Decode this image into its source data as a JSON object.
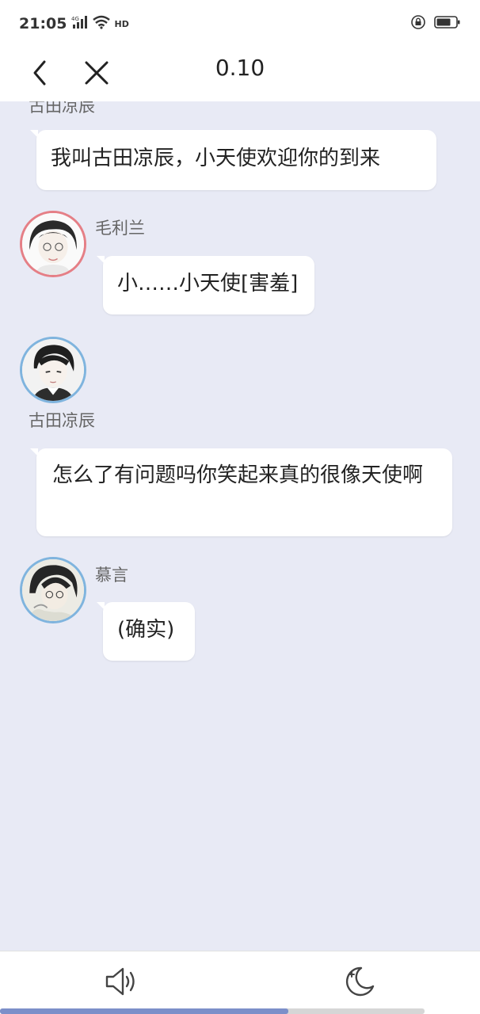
{
  "status_bar": {
    "time": "21:05",
    "network": "4G",
    "hd": "HD",
    "icons": [
      "signal-icon",
      "wifi-icon",
      "lock-rotation-icon",
      "battery-icon"
    ]
  },
  "nav": {
    "title": "0.10",
    "back_icon": "chevron-left-icon",
    "close_icon": "close-icon"
  },
  "messages": [
    {
      "sender": "古田凉辰",
      "text": "我叫古田凉辰，小天使欢迎你的到来"
    },
    {
      "sender": "毛利兰",
      "text": "小……小天使[害羞]"
    },
    {
      "sender": "古田凉辰",
      "text": "怎么了有问题吗你笑起来真的很像天使啊"
    },
    {
      "sender": "慕言",
      "text": "(确实)"
    }
  ],
  "bottom_bar": {
    "speaker_icon": "speaker-icon",
    "night_mode_icon": "moon-icon",
    "progress": 0.68
  },
  "colors": {
    "chat_background": "#e8eaf5",
    "avatar_ring_pink": "#e57f86",
    "avatar_ring_blue": "#7fb4de",
    "progress_fill": "#7c8fc9"
  }
}
